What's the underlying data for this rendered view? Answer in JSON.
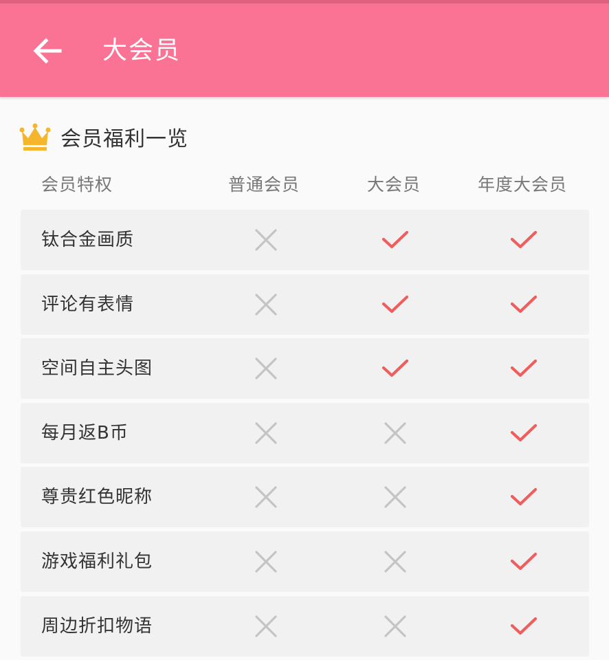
{
  "appbar": {
    "title": "大会员",
    "back_icon": "arrow-left-icon",
    "color": "#fb7394"
  },
  "section": {
    "icon": "crown-icon",
    "icon_color": "#f5b52c",
    "title": "会员福利一览"
  },
  "table": {
    "headers": [
      "会员特权",
      "普通会员",
      "大会员",
      "年度大会员"
    ],
    "check_color": "#ee5e5e",
    "cross_color": "#c4c4c4",
    "rows": [
      {
        "label": "钛合金画质",
        "marks": [
          "cross",
          "check",
          "check"
        ]
      },
      {
        "label": "评论有表情",
        "marks": [
          "cross",
          "check",
          "check"
        ]
      },
      {
        "label": "空间自主头图",
        "marks": [
          "cross",
          "check",
          "check"
        ]
      },
      {
        "label": "每月返B币",
        "marks": [
          "cross",
          "cross",
          "check"
        ]
      },
      {
        "label": "尊贵红色昵称",
        "marks": [
          "cross",
          "cross",
          "check"
        ]
      },
      {
        "label": "游戏福利礼包",
        "marks": [
          "cross",
          "cross",
          "check"
        ]
      },
      {
        "label": "周边折扣物语",
        "marks": [
          "cross",
          "cross",
          "check"
        ]
      }
    ]
  }
}
